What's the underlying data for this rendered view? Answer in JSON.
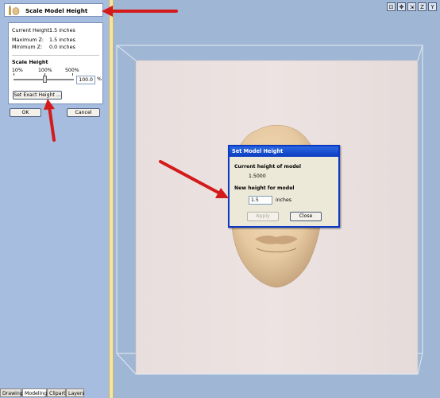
{
  "panel": {
    "title": "Scale Model Height",
    "current_height_label": "Current Height:",
    "current_height_value": "1.5 inches",
    "maximum_z_label": "Maximum Z:",
    "maximum_z_value": "1.5 inches",
    "minimum_z_label": "Minimum Z:",
    "minimum_z_value": "0.0 inches",
    "scale_height_title": "Scale Height",
    "tick_10": "10%",
    "tick_100": "100%",
    "tick_500": "500%",
    "percent_value": "100.0",
    "percent_unit": "%",
    "set_exact_label": "Set Exact Height ...",
    "ok_label": "OK",
    "cancel_label": "Cancel"
  },
  "tabs": [
    "Drawing",
    "Modeling",
    "Clipart",
    "Layers"
  ],
  "active_tab": "Modeling",
  "view_icons": [
    "⊡",
    "✥",
    "⇲",
    "Z",
    "Y"
  ],
  "dialog": {
    "title": "Set Model Height",
    "current_label": "Current height of model",
    "current_value": "1.5000",
    "new_label": "New height for model",
    "new_value": "1.5",
    "unit": "inches",
    "apply_label": "Apply",
    "close_label": "Close"
  },
  "colors": {
    "arrow": "#d41a1a",
    "panel_bg": "#a6bde0",
    "viewport_bg": "#9fb7d4",
    "material": "#e9e0df",
    "face": "#e8cfab",
    "dialog_title": "#0a3cc0"
  }
}
